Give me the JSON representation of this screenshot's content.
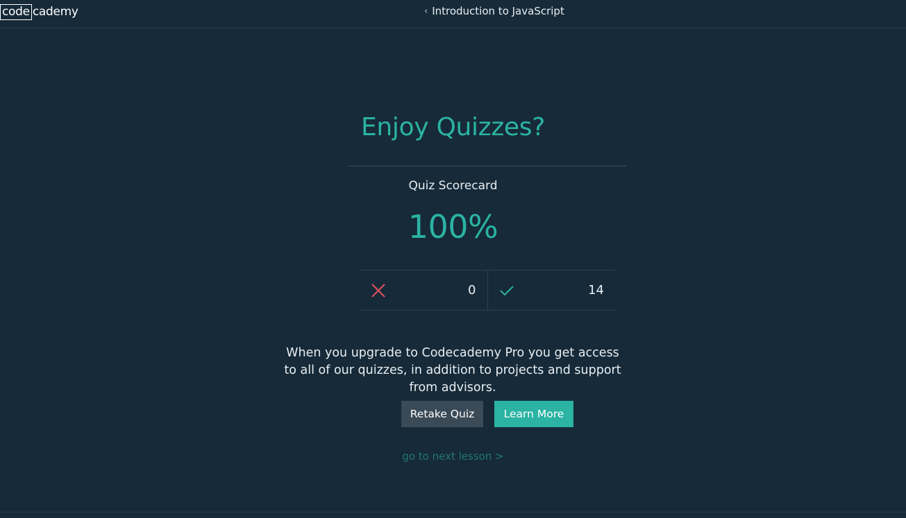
{
  "header": {
    "logo_boxed": "code",
    "logo_rest": "cademy",
    "breadcrumb": "Introduction to JavaScript"
  },
  "quiz": {
    "title": "Enjoy Quizzes?",
    "scorecard_label": "Quiz Scorecard",
    "score_percent": "100%",
    "incorrect_count": "0",
    "correct_count": "14"
  },
  "upsell": {
    "message": "When you upgrade to Codecademy Pro you get access to all of our quizzes, in addition to projects and support from advisors."
  },
  "actions": {
    "retake_label": "Retake Quiz",
    "learn_more_label": "Learn More",
    "next_lesson_label": "go to next lesson >"
  },
  "icons": {
    "incorrect": "close-icon",
    "correct": "check-icon",
    "back": "chevron-left-icon"
  },
  "colors": {
    "background": "#162a39",
    "accent": "#2bb3a3",
    "incorrect": "#e05260",
    "secondary_button": "#3a4a57"
  }
}
